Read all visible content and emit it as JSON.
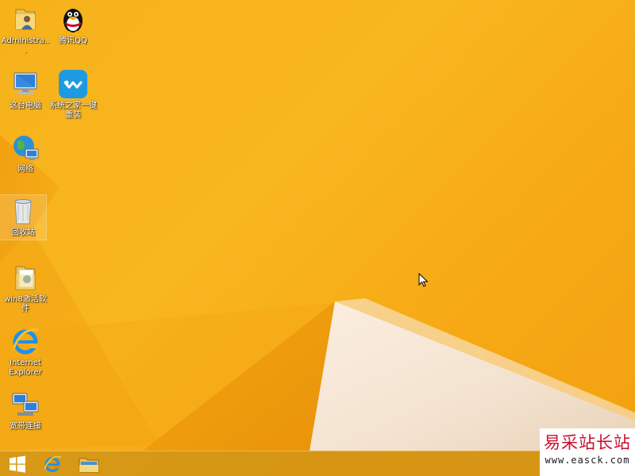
{
  "desktop": {
    "icons": [
      {
        "label": "Administra...",
        "icon": "user-folder-icon"
      },
      {
        "label": "腾讯QQ",
        "icon": "qq-penguin-icon"
      },
      {
        "label": "这台电脑",
        "icon": "this-pc-icon"
      },
      {
        "label": "系统之家一键重装",
        "icon": "reinstall-app-icon"
      },
      {
        "label": "网络",
        "icon": "network-icon"
      },
      {
        "label": "回收站",
        "icon": "recycle-bin-icon"
      },
      {
        "label": "win8激活软件",
        "icon": "folder-icon"
      },
      {
        "label": "Internet Explorer",
        "icon": "internet-explorer-icon"
      },
      {
        "label": "宽带连接",
        "icon": "broadband-connection-icon"
      }
    ],
    "accent_color": "#f7b21a"
  },
  "taskbar": {
    "items": [
      {
        "icon": "windows-start-icon"
      },
      {
        "icon": "internet-explorer-icon"
      },
      {
        "icon": "file-explorer-icon"
      }
    ]
  },
  "watermark": {
    "title": "易采站长站",
    "url": "www.easck.com"
  }
}
